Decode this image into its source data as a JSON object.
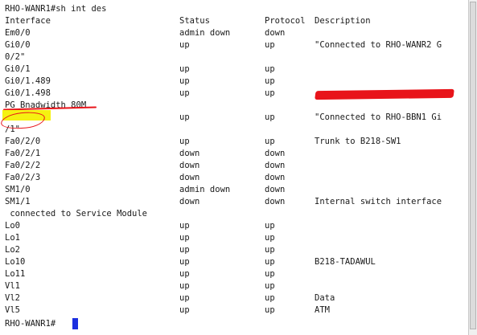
{
  "terminal": {
    "prompt_line": "RHO-WANR1#sh int des",
    "header": {
      "interface": "Interface",
      "status": "Status",
      "protocol": "Protocol",
      "description": "Description"
    },
    "rows": [
      {
        "interface": "Em0/0",
        "status": "admin down",
        "protocol": "down",
        "description": ""
      },
      {
        "interface": "Gi0/0",
        "status": "up",
        "protocol": "up",
        "description": "\"Connected to RHO-WANR2 G"
      },
      {
        "wrap": "0/2\""
      },
      {
        "interface": "Gi0/1",
        "status": "up",
        "protocol": "up",
        "description": ""
      },
      {
        "interface": "Gi0/1.489",
        "status": "up",
        "protocol": "up",
        "description": ""
      },
      {
        "interface": "Gi0/1.498",
        "status": "up",
        "protocol": "up",
        "description": "",
        "redacted": true
      },
      {
        "wrap": "PG Bnadwidth 80M"
      },
      {
        "interface": "Gi0/2",
        "status": "up",
        "protocol": "up",
        "description": "\"Connected to RHO-BBN1 Gi"
      },
      {
        "wrap": "/1\""
      },
      {
        "interface": "Fa0/2/0",
        "status": "up",
        "protocol": "up",
        "description": "Trunk to B218-SW1"
      },
      {
        "interface": "Fa0/2/1",
        "status": "down",
        "protocol": "down",
        "description": ""
      },
      {
        "interface": "Fa0/2/2",
        "status": "down",
        "protocol": "down",
        "description": ""
      },
      {
        "interface": "Fa0/2/3",
        "status": "down",
        "protocol": "down",
        "description": ""
      },
      {
        "interface": "SM1/0",
        "status": "admin down",
        "protocol": "down",
        "description": ""
      },
      {
        "interface": "SM1/1",
        "status": "down",
        "protocol": "down",
        "description": "Internal switch interface"
      },
      {
        "wrap": " connected to Service Module"
      },
      {
        "interface": "Lo0",
        "status": "up",
        "protocol": "up",
        "description": ""
      },
      {
        "interface": "Lo1",
        "status": "up",
        "protocol": "up",
        "description": ""
      },
      {
        "interface": "Lo2",
        "status": "up",
        "protocol": "up",
        "description": ""
      },
      {
        "interface": "Lo10",
        "status": "up",
        "protocol": "up",
        "description": "B218-TADAWUL"
      },
      {
        "interface": "Lo11",
        "status": "up",
        "protocol": "up",
        "description": ""
      },
      {
        "interface": "Vl1",
        "status": "up",
        "protocol": "up",
        "description": ""
      },
      {
        "interface": "Vl2",
        "status": "up",
        "protocol": "up",
        "description": "Data"
      },
      {
        "interface": "Vl5",
        "status": "up",
        "protocol": "up",
        "description": "ATM"
      }
    ],
    "final_prompt": "RHO-WANR1#"
  },
  "colors": {
    "background": "#ffffff",
    "text": "#1a1a1a",
    "highlight": "#f5f211",
    "annotation_red": "#e8141a",
    "cursor": "#1c2fe0"
  }
}
